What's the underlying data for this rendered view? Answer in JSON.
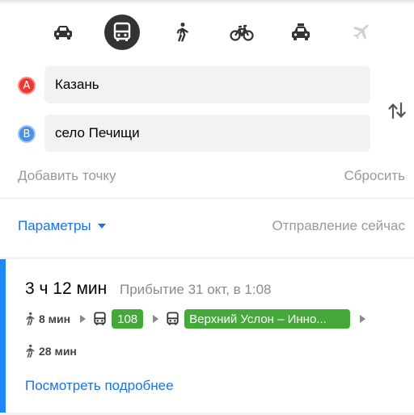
{
  "transport_modes": [
    {
      "name": "car",
      "icon": "car-icon",
      "active": false
    },
    {
      "name": "public-transport",
      "icon": "bus-icon",
      "active": true
    },
    {
      "name": "walking",
      "icon": "walking-icon",
      "active": false
    },
    {
      "name": "bicycle",
      "icon": "bicycle-icon",
      "active": false
    },
    {
      "name": "taxi",
      "icon": "taxi-icon",
      "active": false
    },
    {
      "name": "plane",
      "icon": "plane-icon",
      "active": false
    }
  ],
  "route": {
    "point_a_label": "A",
    "point_b_label": "B",
    "from_value": "Казань",
    "to_value": "село Печищи",
    "add_point": "Добавить точку",
    "reset": "Сбросить"
  },
  "options": {
    "parameters": "Параметры",
    "departure": "Отправление сейчас"
  },
  "result": {
    "duration": "3 ч 12 мин",
    "arrival": "Прибытие 31 окт, в 1:08",
    "walk_start": "8 мин",
    "bus_number": "108",
    "bus_route": "Верхний Услон – Инно...",
    "walk_end": "28 мин",
    "details_link": "Посмотреть подробнее"
  },
  "colors": {
    "accent_blue": "#1a73e8",
    "route_green": "#45a83a",
    "active_mode_bg": "#333333",
    "point_a": "#e53935",
    "point_b": "#4a90e2"
  }
}
